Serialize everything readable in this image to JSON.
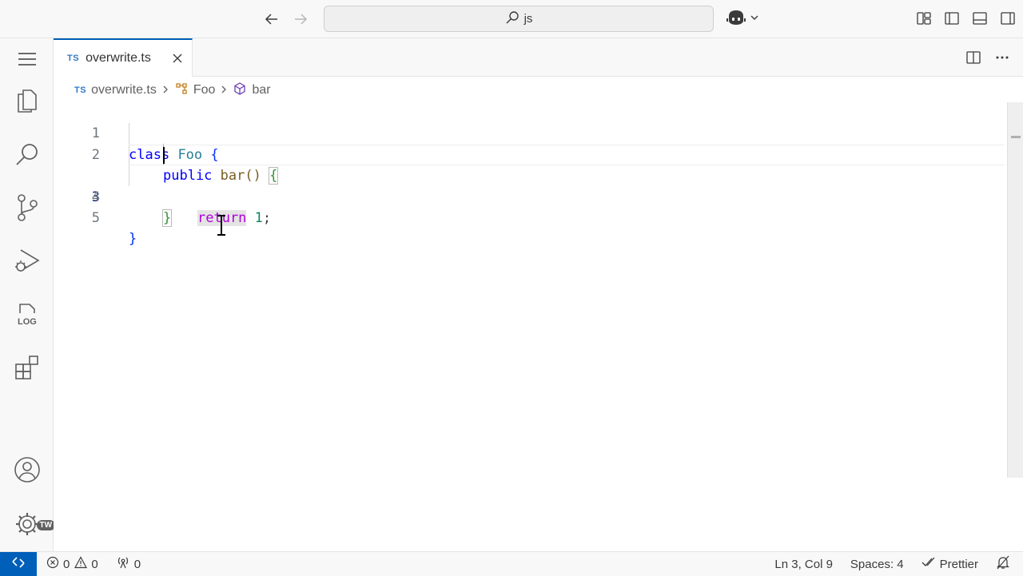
{
  "titlebar": {
    "search_text": "js"
  },
  "tab": {
    "lang_badge": "TS",
    "title": "overwrite.ts"
  },
  "breadcrumb": {
    "lang_badge": "TS",
    "file": "overwrite.ts",
    "class": "Foo",
    "method": "bar"
  },
  "code": {
    "line_numbers": [
      "1",
      "2",
      "3",
      "4",
      "5"
    ],
    "lines": [
      {
        "tokens": [
          "class",
          " ",
          "Foo",
          " ",
          "{"
        ]
      },
      {
        "tokens": [
          "public",
          " ",
          "bar",
          "()",
          " ",
          "{"
        ]
      },
      {
        "tokens": [
          "return",
          " ",
          "1",
          ";"
        ]
      },
      {
        "tokens": [
          "}"
        ]
      },
      {
        "tokens": [
          "}"
        ]
      }
    ]
  },
  "activitybar": {
    "account_badge": "TW"
  },
  "statusbar": {
    "errors": "0",
    "warnings": "0",
    "ports": "0",
    "position": "Ln 3, Col 9",
    "spaces": "Spaces: 4",
    "formatter": "Prettier"
  },
  "colors": {
    "accent": "#005fb8",
    "keyword": "#0000ff",
    "class_name": "#267f99",
    "function": "#795e26",
    "return_keyword": "#af00db",
    "number": "#098658"
  }
}
